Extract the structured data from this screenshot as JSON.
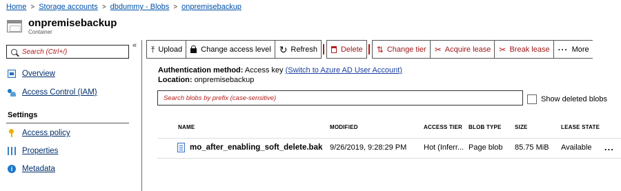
{
  "breadcrumb": [
    "Home",
    "Storage accounts",
    "dbdummy - Blobs",
    "onpremisebackup"
  ],
  "header": {
    "title": "onpremisebackup",
    "subtitle": "Container"
  },
  "sidebar": {
    "search_placeholder": "Search (Ctrl+/)",
    "collapse_glyph": "«",
    "items": [
      {
        "label": "Overview",
        "icon": "overview-icon"
      },
      {
        "label": "Access Control (IAM)",
        "icon": "people-icon"
      }
    ],
    "settings_header": "Settings",
    "settings_items": [
      {
        "label": "Access policy",
        "icon": "key-icon"
      },
      {
        "label": "Properties",
        "icon": "properties-icon"
      },
      {
        "label": "Metadata",
        "icon": "info-icon"
      }
    ]
  },
  "toolbar": {
    "upload": "Upload",
    "change_access_level": "Change access level",
    "refresh": "Refresh",
    "delete": "Delete",
    "change_tier": "Change tier",
    "acquire_lease": "Acquire lease",
    "break_lease": "Break lease",
    "more": "More",
    "accent_color": "#b31b1b"
  },
  "auth": {
    "method_label": "Authentication method:",
    "method_value": "Access key",
    "switch_link": "(Switch to Azure AD User Account)",
    "location_label": "Location:",
    "location_value": "onpremisebackup"
  },
  "blob_search": {
    "placeholder": "Search blobs by prefix (case-sensitive)"
  },
  "show_deleted": {
    "label": "Show deleted blobs",
    "checked": false
  },
  "grid": {
    "columns": [
      "NAME",
      "MODIFIED",
      "ACCESS TIER",
      "BLOB TYPE",
      "SIZE",
      "LEASE STATE"
    ],
    "rows": [
      {
        "name": "mo_after_enabling_soft_delete.bak",
        "modified": "9/26/2019, 9:28:29 PM",
        "access_tier": "Hot (Inferr...",
        "blob_type": "Page blob",
        "size": "85.75 MiB",
        "lease_state": "Available",
        "more": "..."
      }
    ]
  }
}
